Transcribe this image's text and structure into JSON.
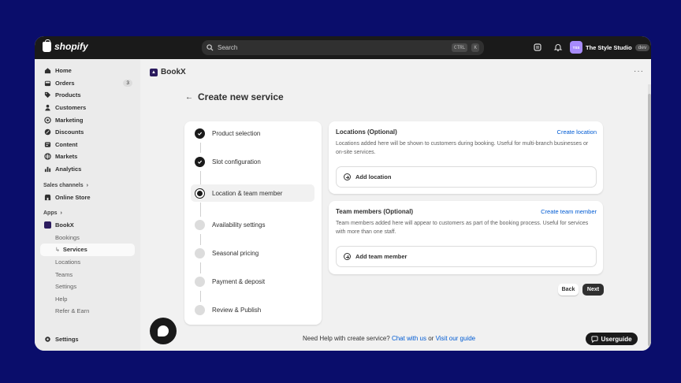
{
  "topbar": {
    "brand": "shopify",
    "search_label": "Search",
    "shortcut_key1": "CTRL",
    "shortcut_key2": "K",
    "store_initials": "TSS",
    "store_name": "The Style Studio",
    "store_badge": "dev"
  },
  "sidebar": {
    "items": [
      {
        "label": "Home",
        "icon": "home-icon"
      },
      {
        "label": "Orders",
        "icon": "orders-icon",
        "badge": "3"
      },
      {
        "label": "Products",
        "icon": "tag-icon"
      },
      {
        "label": "Customers",
        "icon": "person-icon"
      },
      {
        "label": "Marketing",
        "icon": "target-icon"
      },
      {
        "label": "Discounts",
        "icon": "discount-icon"
      },
      {
        "label": "Content",
        "icon": "content-icon"
      },
      {
        "label": "Markets",
        "icon": "globe-icon"
      },
      {
        "label": "Analytics",
        "icon": "bar-chart-icon"
      }
    ],
    "sales_channels_label": "Sales channels",
    "online_store_label": "Online Store",
    "apps_label": "Apps",
    "app_name": "BookX",
    "app_subitems": [
      "Bookings",
      "Services",
      "Locations",
      "Teams",
      "Settings",
      "Help",
      "Refer & Earn"
    ],
    "settings_label": "Settings"
  },
  "main": {
    "app_title": "BookX",
    "page_title": "Create new service",
    "steps": [
      {
        "label": "Product selection",
        "state": "done"
      },
      {
        "label": "Slot configuration",
        "state": "done"
      },
      {
        "label": "Location & team member",
        "state": "current"
      },
      {
        "label": "Availability settings",
        "state": "pending"
      },
      {
        "label": "Seasonal pricing",
        "state": "pending"
      },
      {
        "label": "Payment & deposit",
        "state": "pending"
      },
      {
        "label": "Review & Publish",
        "state": "pending"
      }
    ],
    "locations_card": {
      "title": "Locations (Optional)",
      "link": "Create location",
      "description": "Locations added here will be shown to customers during booking. Useful for multi-branch businesses or on-site services.",
      "add_label": "Add location"
    },
    "team_card": {
      "title": "Team members (Optional)",
      "link": "Create team member",
      "description": "Team members added here will appear to customers as part of the booking process. Useful for services with more than one staff.",
      "add_label": "Add team member"
    },
    "back_label": "Back",
    "next_label": "Next",
    "help_text": "Need Help with create service?",
    "help_link1": "Chat with us",
    "help_or": "or",
    "help_link2": "Visit our guide",
    "userguide_label": "Userguide"
  },
  "colors": {
    "background": "#0a0d6b",
    "topbar": "#1a1a1a",
    "link": "#005bd3",
    "primary_button": "#303030"
  }
}
